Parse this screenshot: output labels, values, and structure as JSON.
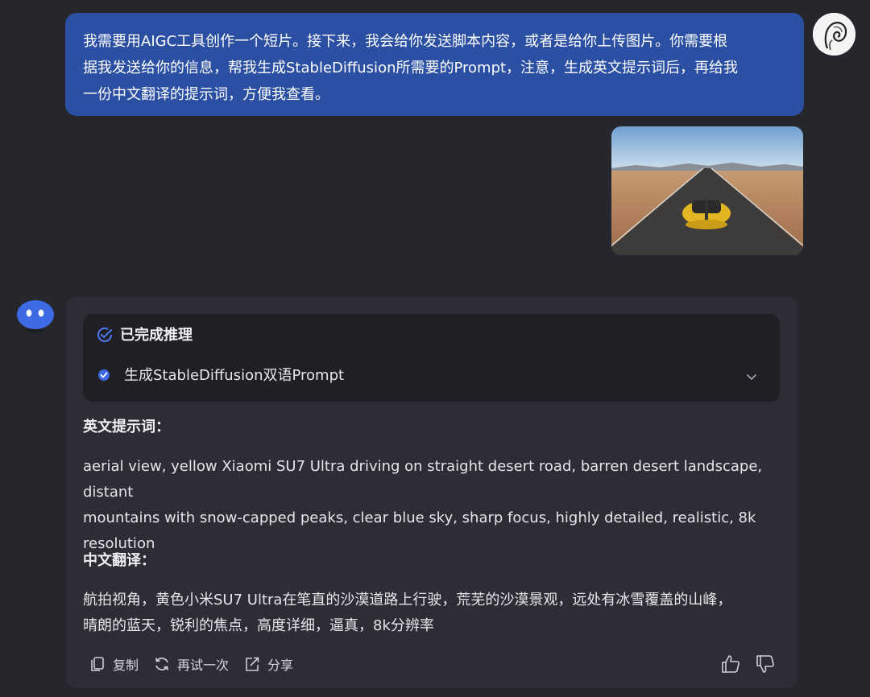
{
  "user_message": {
    "line1": "我需要用AIGC工具创作一个短片。接下来，我会给你发送脚本内容，或者是给你上传图片。你需要根",
    "line2": "据我发送给你的信息，帮我生成StableDiffusion所需要的Prompt，注意，生成英文提示词后，再给我",
    "line3": "一份中文翻译的提示词，方便我查看。"
  },
  "reasoning": {
    "status": "已完成推理",
    "step": "生成StableDiffusion双语Prompt"
  },
  "response": {
    "english_title": "英文提示词：",
    "english_line1": "aerial view, yellow Xiaomi SU7 Ultra driving on straight desert road, barren desert landscape, distant",
    "english_line2": "mountains with snow-capped peaks, clear blue sky, sharp focus, highly detailed, realistic, 8k",
    "english_line3": "resolution",
    "chinese_title": "中文翻译：",
    "chinese_line1": "航拍视角，黄色小米SU7 Ultra在笔直的沙漠道路上行驶，荒芜的沙漠景观，远处有冰雪覆盖的山峰，",
    "chinese_line2": "晴朗的蓝天，锐利的焦点，高度详细，逼真，8k分辨率"
  },
  "actions": {
    "copy": "复制",
    "retry": "再试一次",
    "share": "分享"
  },
  "icons": [
    "copy-icon",
    "retry-icon",
    "share-icon",
    "thumbs-up-icon",
    "thumbs-down-icon",
    "check-circle-icon",
    "chevron-down-icon"
  ],
  "colors": {
    "background": "#26262d",
    "user_bubble": "#2a4fa3",
    "card": "#2d2d35",
    "reasoning_box": "#1f1f25",
    "accent": "#4d7cf2"
  }
}
